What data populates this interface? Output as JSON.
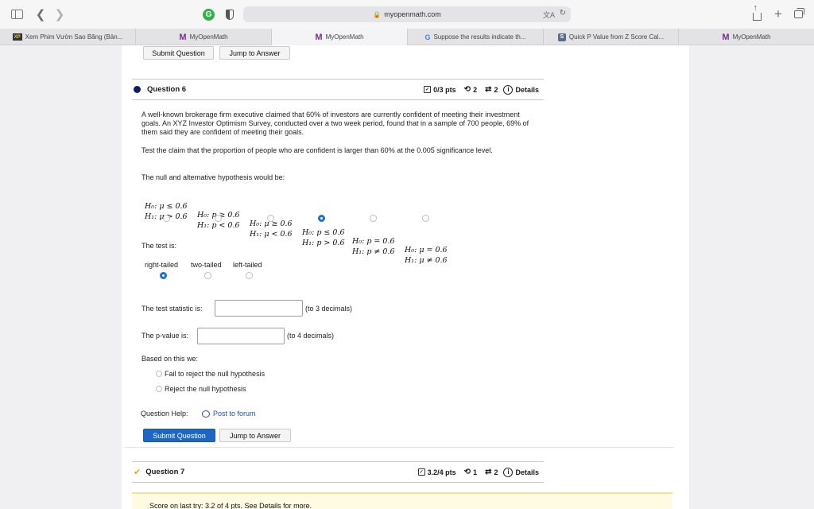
{
  "browser": {
    "url": "myopenmath.com",
    "tabs": [
      {
        "label": "Xem Phim Vườn Sao Băng (Bản...",
        "icon": "xem-phim-favicon"
      },
      {
        "label": "MyOpenMath",
        "icon": "myopenmath-favicon"
      },
      {
        "label": "MyOpenMath",
        "icon": "myopenmath-favicon",
        "active": true
      },
      {
        "label": "Suppose the results indicate th...",
        "icon": "google-favicon"
      },
      {
        "label": "Quick P Value from Z Score Cal...",
        "icon": "s-favicon"
      },
      {
        "label": "MyOpenMath",
        "icon": "myopenmath-favicon"
      }
    ]
  },
  "top_buttons": {
    "submit": "Submit Question",
    "jump": "Jump to Answer"
  },
  "question6": {
    "title": "Question 6",
    "points": "0/3 pts",
    "retries": "2",
    "versions": "2",
    "details": "Details",
    "para1": "A well-known brokerage firm executive claimed that 60% of investors are currently confident of meeting their investment goals. An XYZ Investor Optimism Survey, conducted over a two week period, found that in a sample of 700 people, 69% of them said they are confident of meeting their goals.",
    "para2": "Test the claim that the proportion of people who are confident is larger than 60% at the 0.005 significance level.",
    "hyp_prompt": "The null and alternative hypothesis would be:",
    "hypotheses": [
      {
        "h0": "H₀: μ ≤ 0.6",
        "h1": "H₁: μ > 0.6",
        "selected": false
      },
      {
        "h0": "H₀: p ≥ 0.6",
        "h1": "H₁: p < 0.6",
        "selected": false
      },
      {
        "h0": "H₀: μ ≥ 0.6",
        "h1": "H₁: μ < 0.6",
        "selected": false
      },
      {
        "h0": "H₀: p ≤ 0.6",
        "h1": "H₁: p > 0.6",
        "selected": true
      },
      {
        "h0": "H₀: p = 0.6",
        "h1": "H₁: p ≠ 0.6",
        "selected": false
      },
      {
        "h0": "H₀: μ = 0.6",
        "h1": "H₁: μ ≠ 0.6",
        "selected": false
      }
    ],
    "test_prompt": "The test is:",
    "test_options": [
      {
        "label": "right-tailed",
        "selected": true
      },
      {
        "label": "two-tailed",
        "selected": false
      },
      {
        "label": "left-tailed",
        "selected": false
      }
    ],
    "statistic_label": "The test statistic is:",
    "statistic_value": "",
    "statistic_hint": "(to 3 decimals)",
    "pvalue_label": "The p-value is:",
    "pvalue_value": "",
    "pvalue_hint": "(to 4 decimals)",
    "based_label": "Based on this we:",
    "conclusions": [
      {
        "label": "Fail to reject the null hypothesis",
        "selected": false
      },
      {
        "label": "Reject the null hypothesis",
        "selected": false
      }
    ],
    "help_label": "Question Help:",
    "post_forum": "Post to forum",
    "submit": "Submit Question",
    "jump": "Jump to Answer"
  },
  "question7": {
    "title": "Question 7",
    "points": "3.2/4 pts",
    "retries": "1",
    "versions": "2",
    "details": "Details",
    "score_banner": "Score on last try: 3.2 of 4 pts. See Details for more."
  }
}
